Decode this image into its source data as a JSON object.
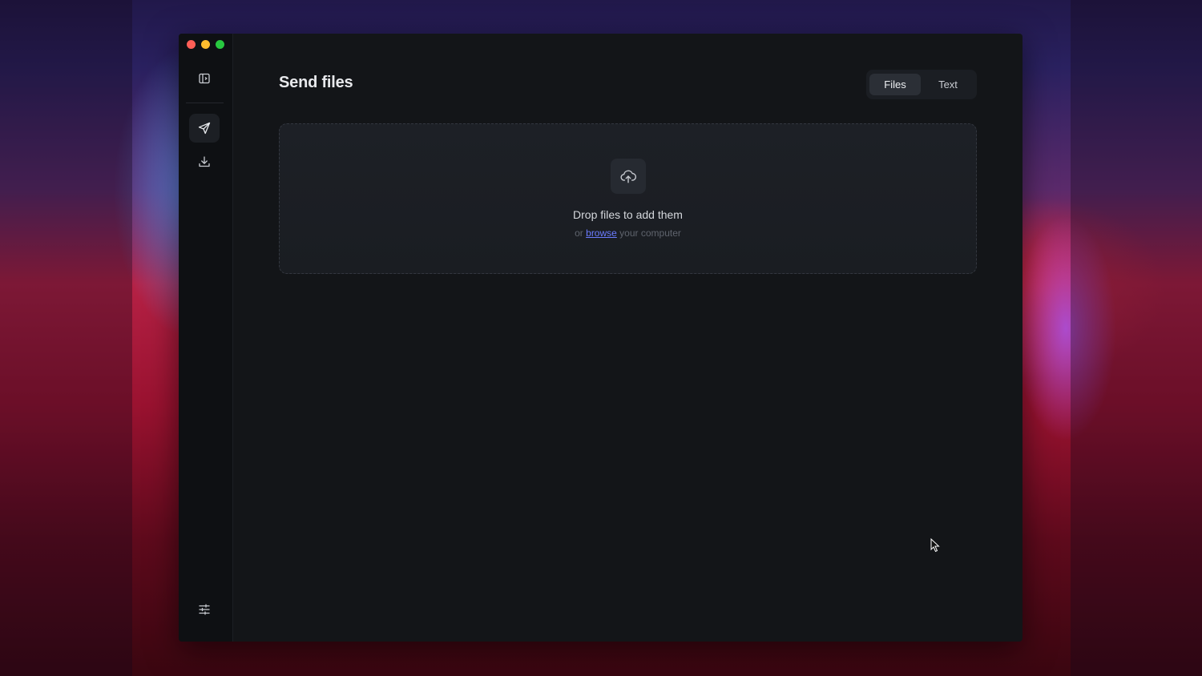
{
  "window": {
    "controls": {
      "close": "close-button",
      "minimize": "minimize-button",
      "zoom": "zoom-button"
    }
  },
  "sidebar": {
    "items": [
      {
        "id": "toggle-sidebar",
        "icon": "sidebar-toggle-icon",
        "active": false
      },
      {
        "id": "send",
        "icon": "paper-plane-icon",
        "active": true
      },
      {
        "id": "receive",
        "icon": "download-icon",
        "active": false
      },
      {
        "id": "settings",
        "icon": "sliders-icon",
        "active": false
      }
    ]
  },
  "main": {
    "title": "Send files",
    "mode_tabs": [
      {
        "label": "Files",
        "active": true
      },
      {
        "label": "Text",
        "active": false
      }
    ],
    "dropzone": {
      "icon": "cloud-upload-icon",
      "title": "Drop files to add them",
      "subtitle_prefix": "or",
      "browse_link": "browse",
      "subtitle_suffix": "your computer"
    }
  },
  "colors": {
    "window_bg": "#131518",
    "sidebar_bg": "#0e1013",
    "link": "#6b7cff",
    "close": "#ff5f57",
    "minimize": "#febc2e",
    "zoom": "#28c840"
  }
}
